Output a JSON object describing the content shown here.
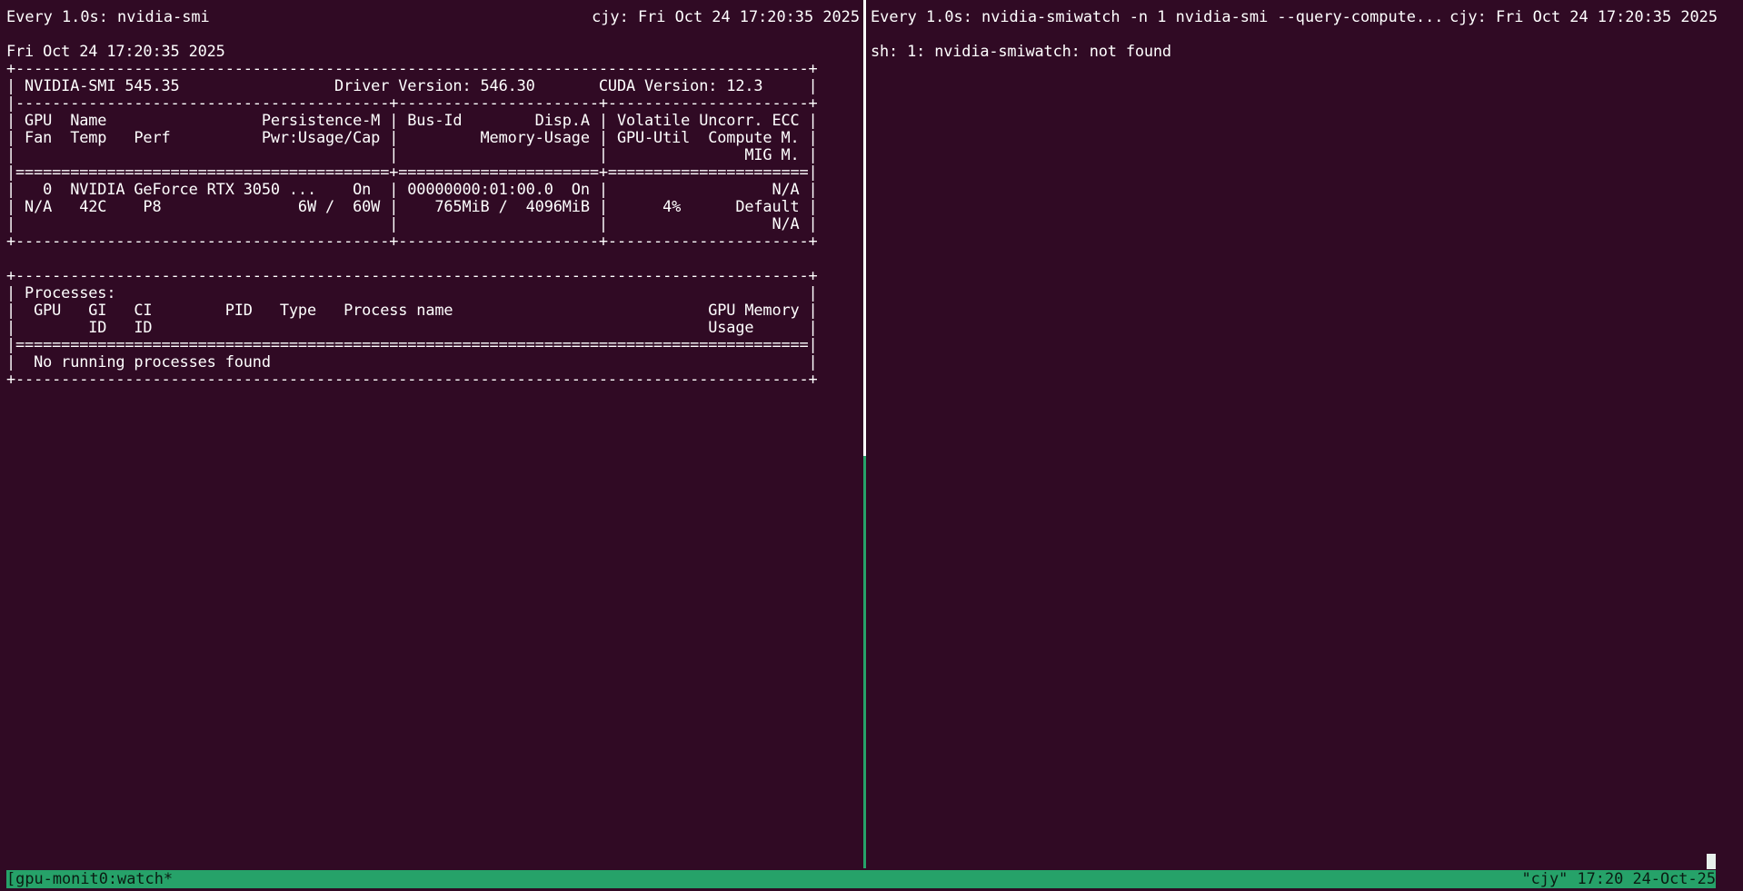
{
  "left_pane": {
    "header_command": "Every 1.0s: nvidia-smi",
    "header_host_time": "cjy: Fri Oct 24 17:20:35 2025",
    "output_lines": [
      "Fri Oct 24 17:20:35 2025",
      "+---------------------------------------------------------------------------------------+",
      "| NVIDIA-SMI 545.35                 Driver Version: 546.30       CUDA Version: 12.3     |",
      "|-----------------------------------------+----------------------+----------------------+",
      "| GPU  Name                 Persistence-M | Bus-Id        Disp.A | Volatile Uncorr. ECC |",
      "| Fan  Temp   Perf          Pwr:Usage/Cap |         Memory-Usage | GPU-Util  Compute M. |",
      "|                                         |                      |               MIG M. |",
      "|=========================================+======================+======================|",
      "|   0  NVIDIA GeForce RTX 3050 ...    On  | 00000000:01:00.0  On |                  N/A |",
      "| N/A   42C    P8               6W /  60W |    765MiB /  4096MiB |      4%      Default |",
      "|                                         |                      |                  N/A |",
      "+-----------------------------------------+----------------------+----------------------+",
      "",
      "+---------------------------------------------------------------------------------------+",
      "| Processes:                                                                            |",
      "|  GPU   GI   CI        PID   Type   Process name                            GPU Memory |",
      "|        ID   ID                                                             Usage      |",
      "|=======================================================================================|",
      "|  No running processes found                                                           |",
      "+---------------------------------------------------------------------------------------+"
    ]
  },
  "right_pane": {
    "header_command": "Every 1.0s: nvidia-smiwatch -n 1 nvidia-smi --query-compute...",
    "header_host_time": "cjy: Fri Oct 24 17:20:35 2025",
    "output_lines": [
      "sh: 1: nvidia-smiwatch: not found"
    ]
  },
  "status_bar": {
    "session_window": "[gpu-monit0:watch*",
    "host_time_date": "\"cjy\" 17:20 24-Oct-25"
  },
  "colors": {
    "background": "#300a24",
    "foreground": "#ffffff",
    "status_bar": "#26a269",
    "active_pane_border": "#26a269"
  }
}
